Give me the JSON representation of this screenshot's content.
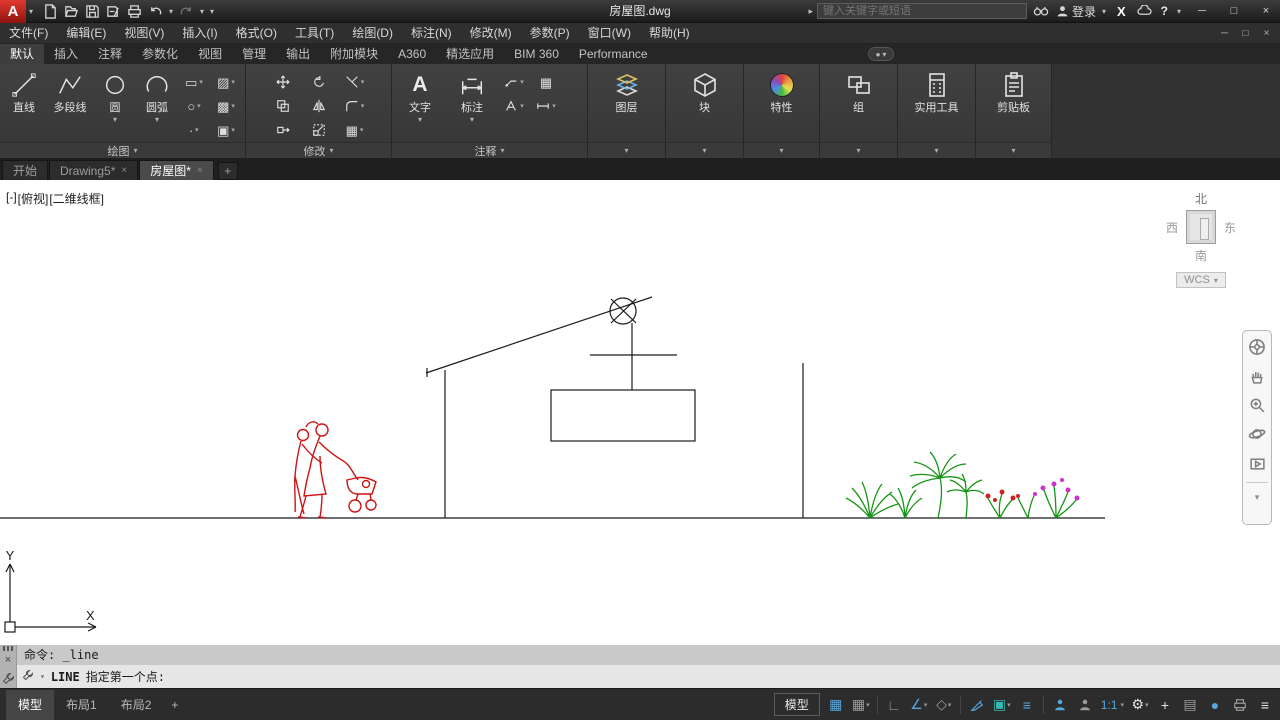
{
  "glyphs": {
    "dropdown": "▾",
    "flyout": "▸",
    "min": "─",
    "max": "□",
    "close": "×",
    "grid": "▦",
    "square": "▣",
    "sheet": "▤",
    "ortho": "∟",
    "angle": "∠",
    "diamond": "◇",
    "lines": "≡",
    "gear": "⚙",
    "dot": "●",
    "plus": "+",
    "circle": "○",
    "rect": "▭",
    "hatch": "▨",
    "gradient": "▩",
    "point": "∙",
    "letterA": "A"
  },
  "colors": {
    "logo_red": "#c8171e",
    "entity_red": "#cc1414",
    "plant_green": "#169416",
    "flower_magenta": "#cc33cc",
    "flower_red": "#cc2222",
    "accent_blue": "#57a8e0",
    "osnap_teal": "#35b8b0"
  },
  "titlebar": {
    "logo": "A",
    "title": "房屋图.dwg",
    "search_placeholder": "键入关键字或短语",
    "signin": "登录",
    "exchange": "X",
    "help": "?"
  },
  "menubar": {
    "items": [
      "文件(F)",
      "编辑(E)",
      "视图(V)",
      "插入(I)",
      "格式(O)",
      "工具(T)",
      "绘图(D)",
      "标注(N)",
      "修改(M)",
      "参数(P)",
      "窗口(W)",
      "帮助(H)"
    ]
  },
  "ribbon_tabs": {
    "items": [
      "默认",
      "插入",
      "注释",
      "参数化",
      "视图",
      "管理",
      "输出",
      "附加模块",
      "A360",
      "精选应用",
      "BIM 360",
      "Performance"
    ]
  },
  "ribbon": {
    "draw_panel": {
      "label": "绘图",
      "line": "直线",
      "polyline": "多段线",
      "circle": "圆",
      "arc": "圆弧"
    },
    "modify_panel": {
      "label": "修改"
    },
    "annotate_panel": {
      "label": "注释",
      "text": "文字",
      "dimension": "标注"
    },
    "layers_panel": {
      "label": "图层"
    },
    "block_panel": {
      "label": "块"
    },
    "properties_panel": {
      "label": "特性"
    },
    "groups_panel": {
      "label": "组"
    },
    "utilities_panel": {
      "label": "实用工具"
    },
    "clipboard_panel": {
      "label": "剪贴板"
    }
  },
  "file_tabs": {
    "start": "开始",
    "drawing5": "Drawing5*",
    "house": "房屋图*"
  },
  "canvas": {
    "viewport_minus": "[-]",
    "viewport_view": "[俯视]",
    "viewport_style": "[二维线框]",
    "viewcube": {
      "north": "北",
      "west": "西",
      "east": "东",
      "south": "南",
      "wcs": "WCS"
    },
    "ucs": {
      "x": "X",
      "y": "Y"
    }
  },
  "command": {
    "history": "命令: _line",
    "prompt_command": "LINE",
    "prompt": "指定第一个点:"
  },
  "statusbar": {
    "model_tab": "模型",
    "layout1_tab": "布局1",
    "layout2_tab": "布局2",
    "model_button": "模型",
    "scale": "1:1"
  }
}
